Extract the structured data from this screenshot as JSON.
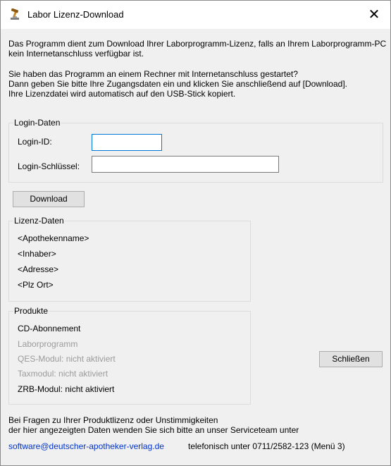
{
  "window": {
    "title": "Labor Lizenz-Download",
    "close_label": "✕"
  },
  "intro": {
    "line1": "Das Programm dient zum Download Ihrer Laborprogramm-Lizenz, falls an Ihrem Laborprogramm-PC",
    "line2": "kein Internetanschluss verfügbar ist.",
    "line3": "Sie haben das Programm an einem Rechner mit Internetanschluss gestartet?",
    "line4": "Dann geben Sie bitte Ihre Zugangsdaten ein und klicken Sie anschließend auf [Download].",
    "line5": "Ihre Lizenzdatei wird automatisch auf den USB-Stick kopiert."
  },
  "login": {
    "group_title": "Login-Daten",
    "id_label": "Login-ID:",
    "id_value": "",
    "key_label": "Login-Schlüssel:",
    "key_value": ""
  },
  "download_button": "Download",
  "license": {
    "group_title": "Lizenz-Daten",
    "pharmacy_name": "<Apothekenname>",
    "owner": "<Inhaber>",
    "address": "<Adresse>",
    "zip_city": "<Plz Ort>"
  },
  "products": {
    "group_title": "Produkte",
    "items": [
      {
        "label": "CD-Abonnement",
        "active": true
      },
      {
        "label": "Laborprogramm",
        "active": false
      },
      {
        "label": "QES-Modul: nicht aktiviert",
        "active": false
      },
      {
        "label": "Taxmodul: nicht aktiviert",
        "active": false
      },
      {
        "label": "ZRB-Modul: nicht aktiviert",
        "active": true
      }
    ]
  },
  "close_button": "Schließen",
  "footer": {
    "line1": "Bei Fragen zu Ihrer Produktlizenz oder Unstimmigkeiten",
    "line2": "der hier angezeigten Daten wenden Sie sich bitte an unser Serviceteam unter",
    "email": "software@deutscher-apotheker-verlag.de",
    "phone": "telefonisch unter 0711/2582-123 (Menü 3)"
  },
  "colors": {
    "accent_focus": "#0078d7",
    "link": "#0033cc",
    "disabled_text": "#9b9b9b",
    "window_bg": "#f0f0f0",
    "icon_wood": "#c28a2c",
    "icon_silver": "#7d7d7d"
  },
  "icons": {
    "app": "gavel-icon",
    "close": "close-icon"
  }
}
